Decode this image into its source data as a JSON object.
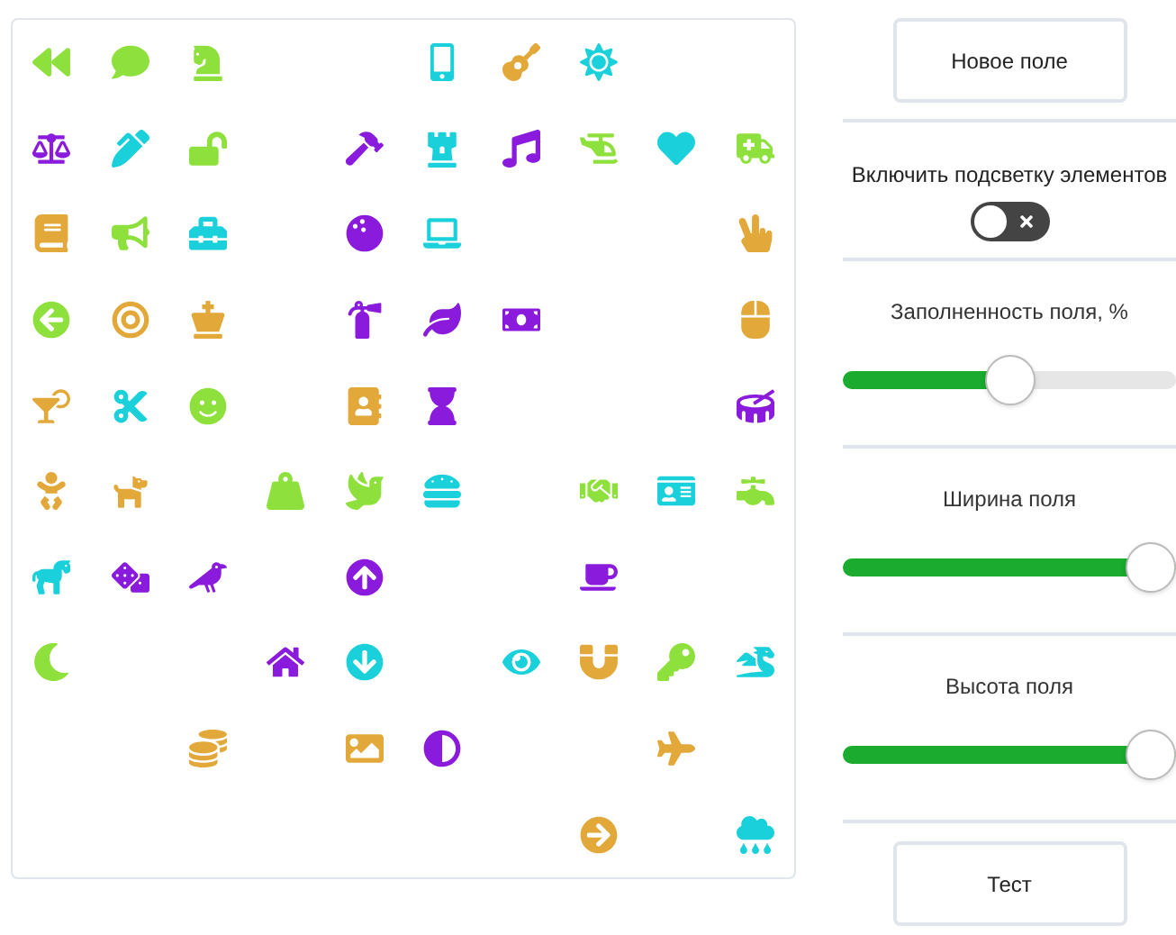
{
  "icon_grid": [
    [
      {
        "kind": "backward",
        "color": "#8ee13c"
      },
      {
        "kind": "comment",
        "color": "#8ee13c"
      },
      {
        "kind": "knight",
        "color": "#8ee13c"
      },
      {
        "kind": "empty"
      },
      {
        "kind": "empty"
      },
      {
        "kind": "mobile",
        "color": "#1ad1db"
      },
      {
        "kind": "guitar",
        "color": "#e3a83a"
      },
      {
        "kind": "sun",
        "color": "#1ad1db"
      },
      {
        "kind": "empty"
      },
      {
        "kind": "empty"
      }
    ],
    [
      {
        "kind": "scale",
        "color": "#8a1bdc"
      },
      {
        "kind": "pen",
        "color": "#1ad1db"
      },
      {
        "kind": "unlock",
        "color": "#8ee13c"
      },
      {
        "kind": "empty"
      },
      {
        "kind": "hammer",
        "color": "#8a1bdc"
      },
      {
        "kind": "rook",
        "color": "#1ad1db"
      },
      {
        "kind": "music",
        "color": "#8a1bdc"
      },
      {
        "kind": "helicopter",
        "color": "#8ee13c"
      },
      {
        "kind": "heart",
        "color": "#1ad1db"
      },
      {
        "kind": "ambulance",
        "color": "#8ee13c"
      }
    ],
    [
      {
        "kind": "book",
        "color": "#e3a83a"
      },
      {
        "kind": "bullhorn",
        "color": "#8ee13c"
      },
      {
        "kind": "toolbox",
        "color": "#1ad1db"
      },
      {
        "kind": "empty"
      },
      {
        "kind": "bowling",
        "color": "#8a1bdc"
      },
      {
        "kind": "laptop",
        "color": "#1ad1db"
      },
      {
        "kind": "empty"
      },
      {
        "kind": "empty"
      },
      {
        "kind": "empty"
      },
      {
        "kind": "peace",
        "color": "#e3a83a"
      }
    ],
    [
      {
        "kind": "left",
        "color": "#8ee13c"
      },
      {
        "kind": "bullseye",
        "color": "#e3a83a"
      },
      {
        "kind": "king",
        "color": "#e3a83a"
      },
      {
        "kind": "empty"
      },
      {
        "kind": "extinguisher",
        "color": "#8a1bdc"
      },
      {
        "kind": "leaf",
        "color": "#8a1bdc"
      },
      {
        "kind": "money",
        "color": "#8a1bdc"
      },
      {
        "kind": "empty"
      },
      {
        "kind": "empty"
      },
      {
        "kind": "mouse",
        "color": "#e3a83a"
      }
    ],
    [
      {
        "kind": "cocktail",
        "color": "#e3a83a"
      },
      {
        "kind": "scissors",
        "color": "#1ad1db"
      },
      {
        "kind": "smile",
        "color": "#8ee13c"
      },
      {
        "kind": "empty"
      },
      {
        "kind": "contacts",
        "color": "#e3a83a"
      },
      {
        "kind": "hourglass",
        "color": "#8a1bdc"
      },
      {
        "kind": "empty"
      },
      {
        "kind": "empty"
      },
      {
        "kind": "empty"
      },
      {
        "kind": "drum",
        "color": "#8a1bdc"
      }
    ],
    [
      {
        "kind": "baby",
        "color": "#e3a83a"
      },
      {
        "kind": "dog",
        "color": "#e3a83a"
      },
      {
        "kind": "empty"
      },
      {
        "kind": "weight",
        "color": "#8ee13c"
      },
      {
        "kind": "dove",
        "color": "#8ee13c"
      },
      {
        "kind": "burger",
        "color": "#1ad1db"
      },
      {
        "kind": "empty"
      },
      {
        "kind": "handshake",
        "color": "#8ee13c"
      },
      {
        "kind": "idcard",
        "color": "#1ad1db"
      },
      {
        "kind": "faucet",
        "color": "#8ee13c"
      }
    ],
    [
      {
        "kind": "horse",
        "color": "#1ad1db"
      },
      {
        "kind": "dice",
        "color": "#8a1bdc"
      },
      {
        "kind": "crow",
        "color": "#8a1bdc"
      },
      {
        "kind": "empty"
      },
      {
        "kind": "up",
        "color": "#8a1bdc"
      },
      {
        "kind": "empty"
      },
      {
        "kind": "empty"
      },
      {
        "kind": "mug",
        "color": "#8a1bdc"
      },
      {
        "kind": "empty"
      },
      {
        "kind": "empty"
      }
    ],
    [
      {
        "kind": "moon",
        "color": "#8ee13c"
      },
      {
        "kind": "empty"
      },
      {
        "kind": "empty"
      },
      {
        "kind": "home",
        "color": "#8a1bdc"
      },
      {
        "kind": "down",
        "color": "#1ad1db"
      },
      {
        "kind": "empty"
      },
      {
        "kind": "eye",
        "color": "#1ad1db"
      },
      {
        "kind": "magnet",
        "color": "#e3a83a"
      },
      {
        "kind": "key",
        "color": "#8ee13c"
      },
      {
        "kind": "dragon",
        "color": "#1ad1db"
      }
    ],
    [
      {
        "kind": "empty"
      },
      {
        "kind": "empty"
      },
      {
        "kind": "coins",
        "color": "#e3a83a"
      },
      {
        "kind": "empty"
      },
      {
        "kind": "image",
        "color": "#e3a83a"
      },
      {
        "kind": "contrast",
        "color": "#8a1bdc"
      },
      {
        "kind": "empty"
      },
      {
        "kind": "empty"
      },
      {
        "kind": "plane",
        "color": "#e3a83a"
      },
      {
        "kind": "empty"
      }
    ],
    [
      {
        "kind": "empty"
      },
      {
        "kind": "empty"
      },
      {
        "kind": "empty"
      },
      {
        "kind": "empty"
      },
      {
        "kind": "empty"
      },
      {
        "kind": "empty"
      },
      {
        "kind": "empty"
      },
      {
        "kind": "right",
        "color": "#e3a83a"
      },
      {
        "kind": "empty"
      },
      {
        "kind": "rain",
        "color": "#1ad1db"
      }
    ]
  ],
  "new_field_button": "Новое поле",
  "highlight_toggle": {
    "label": "Включить подсветку элементов",
    "on": false
  },
  "sliders": [
    {
      "label": "Заполненность поля, %",
      "level": 0.5
    },
    {
      "label": "Ширина поля",
      "level": 1
    },
    {
      "label": "Высота поля",
      "level": 1
    }
  ],
  "test_button": "Тест"
}
